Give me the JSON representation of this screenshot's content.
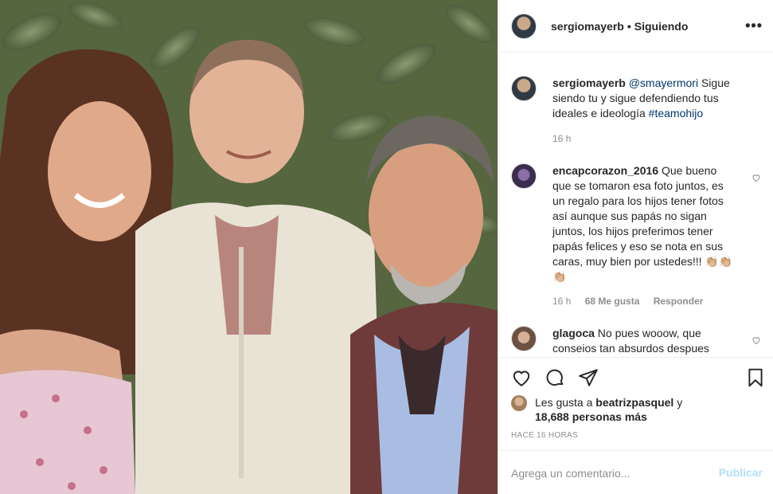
{
  "post": {
    "username": "sergiomayerb",
    "separator": "•",
    "follow_state": "Siguiendo",
    "more_icon": "more-horizontal-icon",
    "accent_link": "#00376b",
    "post_button_color": "#b2dffc"
  },
  "caption": {
    "username": "sergiomayerb",
    "mention": "@smayermori",
    "text": "Sigue siendo tu y sigue defendiendo tus ideales e ideología",
    "hashtag": "#teamohijo",
    "time": "16 h"
  },
  "comments": [
    {
      "username": "encapcorazon_2016",
      "text": "Que bueno que se tomaron esa foto juntos, es un regalo para los hijos tener fotos así aunque sus papás no sigan juntos, los hijos preferimos tener papás felices y eso se nota en sus caras, muy bien por ustedes!!! 👏🏼👏🏼👏🏼",
      "time": "16 h",
      "likes": "68 Me gusta",
      "reply": "Responder"
    },
    {
      "username": "glagoca",
      "text": "No pues wooow, que conseios tan absurdos despues"
    }
  ],
  "likes": {
    "prefix": "Les gusta a",
    "user": "beatrizpasquel",
    "conj": "y",
    "count": "18,688 personas más"
  },
  "timestamp": "HACE 16 HORAS",
  "add_comment": {
    "placeholder": "Agrega un comentario...",
    "post_label": "Publicar"
  }
}
